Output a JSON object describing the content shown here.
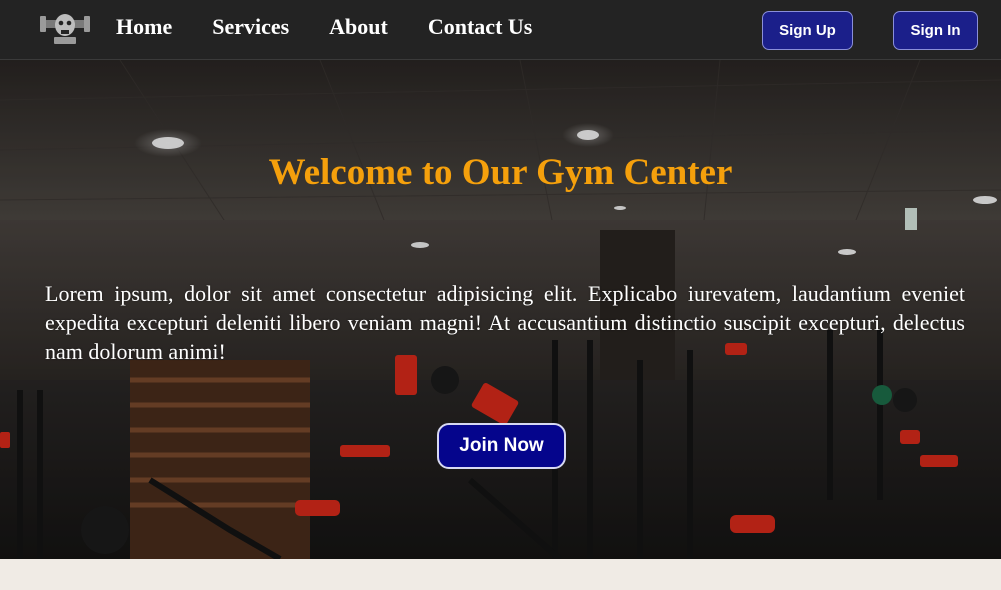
{
  "nav": {
    "links": [
      "Home",
      "Services",
      "About",
      "Contact Us"
    ],
    "signup_label": "Sign Up",
    "signin_label": "Sign In"
  },
  "hero": {
    "title": "Welcome to Our Gym Center",
    "text": "Lorem ipsum, dolor sit amet consectetur adipisicing elit. Explicabo iurevatem, laudantium eveniet expedita excepturi deleniti libero veniam magni! At accusantium distinctio suscipit excepturi, delectus nam dolorum animi!",
    "cta_label": "Join Now"
  },
  "colors": {
    "navbar": "#232323",
    "accent_title": "#f5a00c",
    "button": "#1b1f8a",
    "cta": "#05058c",
    "page_bg": "#f0ebe5"
  }
}
